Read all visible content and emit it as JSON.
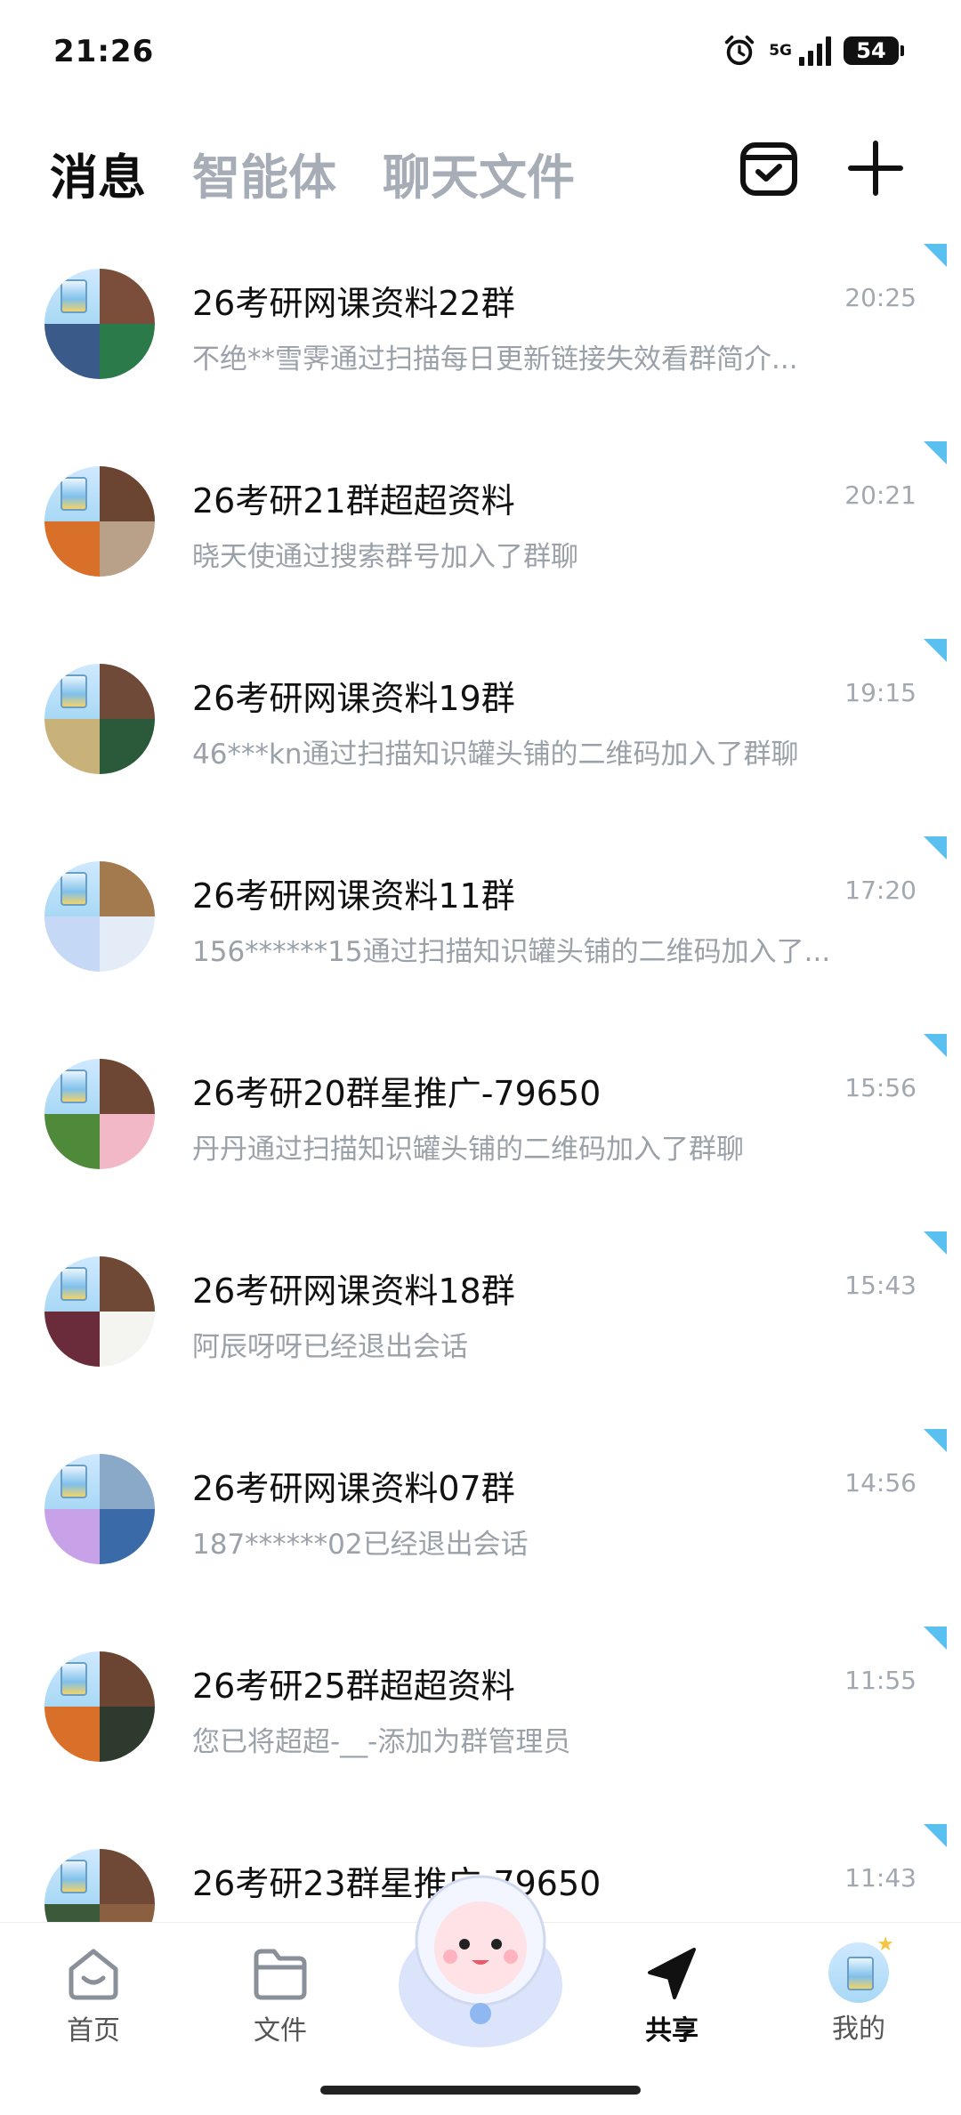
{
  "status_bar": {
    "time": "21:26",
    "network": "5G",
    "battery": "54"
  },
  "tabs": [
    {
      "label": "消息",
      "active": true
    },
    {
      "label": "智能体",
      "active": false
    },
    {
      "label": "聊天文件",
      "active": false
    }
  ],
  "header_icons": {
    "calendar": "calendar-check-icon",
    "add": "plus-icon"
  },
  "conversations": [
    {
      "title": "26考研网课资料22群",
      "time": "20:25",
      "preview": "不绝**雪霁通过扫描每日更新链接失效看群简介...",
      "pinned": true
    },
    {
      "title": "26考研21群超超资料",
      "time": "20:21",
      "preview": "晓天使通过搜索群号加入了群聊",
      "pinned": true
    },
    {
      "title": "26考研网课资料19群",
      "time": "19:15",
      "preview": "46***kn通过扫描知识罐头铺的二维码加入了群聊",
      "pinned": true
    },
    {
      "title": "26考研网课资料11群",
      "time": "17:20",
      "preview": "156******15通过扫描知识罐头铺的二维码加入了...",
      "pinned": true
    },
    {
      "title": "26考研20群星推广-79650",
      "time": "15:56",
      "preview": "丹丹通过扫描知识罐头铺的二维码加入了群聊",
      "pinned": true
    },
    {
      "title": "26考研网课资料18群",
      "time": "15:43",
      "preview": "阿辰呀呀已经退出会话",
      "pinned": true
    },
    {
      "title": "26考研网课资料07群",
      "time": "14:56",
      "preview": "187******02已经退出会话",
      "pinned": true
    },
    {
      "title": "26考研25群超超资料",
      "time": "11:55",
      "preview": "您已将超超-__-添加为群管理员",
      "pinned": true
    },
    {
      "title": "26考研23群星推广-79650",
      "time": "11:43",
      "preview": "",
      "pinned": true
    }
  ],
  "bottom_nav": [
    {
      "label": "首页",
      "icon": "home-icon",
      "active": false
    },
    {
      "label": "文件",
      "icon": "folder-icon",
      "active": false
    },
    {
      "label": "共享",
      "icon": "send-icon",
      "active": true
    },
    {
      "label": "我的",
      "icon": "profile-avatar",
      "active": false
    }
  ],
  "colors": {
    "accent_pin": "#5ac0f0",
    "muted_text": "#9ba1a9",
    "active_text": "#0e0e0e"
  }
}
